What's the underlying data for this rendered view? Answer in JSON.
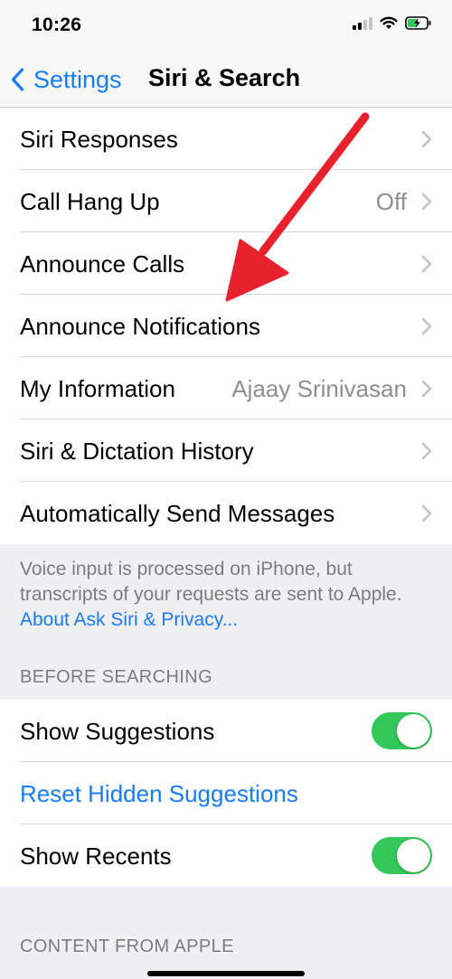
{
  "status_bar": {
    "time": "10:26"
  },
  "nav": {
    "back_label": "Settings",
    "title": "Siri & Search"
  },
  "main_group": {
    "items": [
      {
        "label": "Siri Responses",
        "value": ""
      },
      {
        "label": "Call Hang Up",
        "value": "Off"
      },
      {
        "label": "Announce Calls",
        "value": ""
      },
      {
        "label": "Announce Notifications",
        "value": ""
      },
      {
        "label": "My Information",
        "value": "Ajaay Srinivasan"
      },
      {
        "label": "Siri & Dictation History",
        "value": ""
      },
      {
        "label": "Automatically Send Messages",
        "value": ""
      }
    ]
  },
  "footer": {
    "text": "Voice input is processed on iPhone, but transcripts of your requests are sent to Apple.",
    "link": "About Ask Siri & Privacy..."
  },
  "before_searching": {
    "header": "BEFORE SEARCHING",
    "show_suggestions": {
      "label": "Show Suggestions",
      "on": true
    },
    "reset_hidden": {
      "label": "Reset Hidden Suggestions"
    },
    "show_recents": {
      "label": "Show Recents",
      "on": true
    }
  },
  "content_from_apple": {
    "header": "CONTENT FROM APPLE"
  },
  "colors": {
    "accent": "#1a7cf5",
    "toggle_on": "#34c759",
    "annotation_arrow": "#e8222c"
  },
  "annotation": {
    "icon": "red-arrow-icon",
    "points_to": "Announce Notifications"
  }
}
